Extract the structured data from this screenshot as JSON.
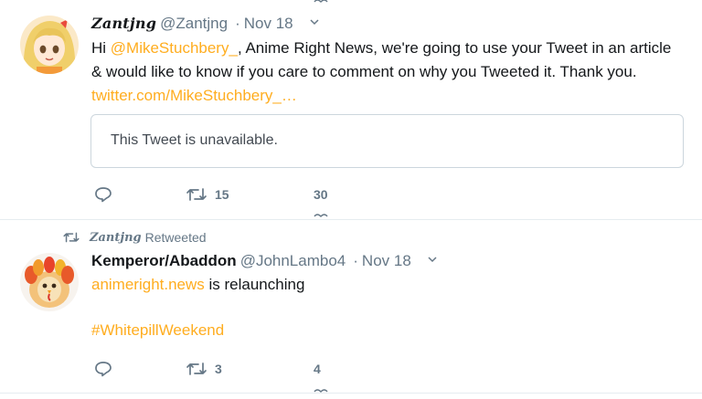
{
  "tweet1": {
    "display_name": "Zantjng",
    "handle": "@Zantjng",
    "separator": "·",
    "date": "Nov 18",
    "text_before": "Hi ",
    "mention": "@MikeStuchbery_",
    "text_after": ", Anime Right News, we're going to use your Tweet in an article & would like to know if you care to comment on why you Tweeted it. Thank you. ",
    "link": "twitter.com/MikeStuchbery_…",
    "quoted_unavailable": "This Tweet is unavailable.",
    "reply_count": "",
    "retweet_count": "15",
    "like_count": "30",
    "icons": {
      "reply": "reply-icon",
      "retweet": "retweet-icon",
      "like": "like-icon",
      "caret": "chevron-down-icon"
    }
  },
  "tweet2": {
    "retweeted_by": "Zantjng",
    "retweeted_label": "Retweeted",
    "display_name": "Kemperor/Abaddon",
    "handle": "@JohnLambo4",
    "separator": "·",
    "date": "Nov 18",
    "link": "animeright.news",
    "text": " is relaunching",
    "hashtag": "#WhitepillWeekend",
    "retweet_count": "3",
    "like_count": "4",
    "icons": {
      "reply": "reply-icon",
      "retweet": "retweet-icon",
      "like": "like-icon",
      "caret": "chevron-down-icon"
    }
  },
  "colors": {
    "link": "#ffad1f",
    "secondary": "#657786",
    "border": "#e6ecf0",
    "text": "#14171a"
  }
}
